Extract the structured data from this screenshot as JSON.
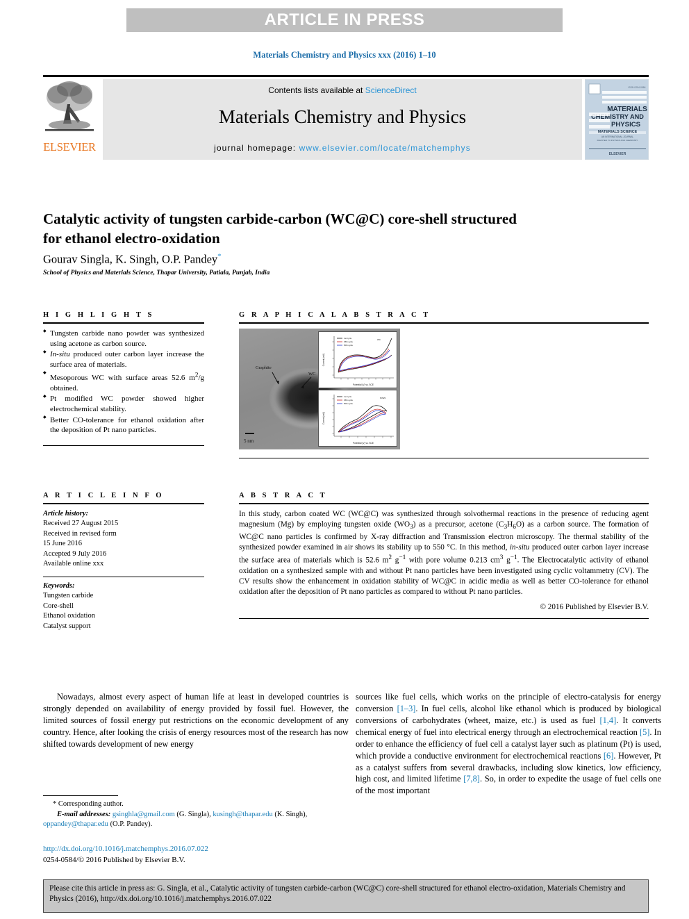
{
  "banner": {
    "text": "ARTICLE IN PRESS"
  },
  "running_head": "Materials Chemistry and Physics xxx (2016) 1–10",
  "masthead": {
    "contents_prefix": "Contents lists available at ",
    "contents_link": "ScienceDirect",
    "journal_name": "Materials Chemistry and Physics",
    "homepage_prefix": "journal homepage: ",
    "homepage_url": "www.elsevier.com/locate/matchemphys",
    "publisher_logo_text": "ELSEVIER",
    "cover_title_lines": [
      "MATERIALS",
      "CHEMISTRY AND",
      "PHYSICS"
    ]
  },
  "article": {
    "title": "Catalytic activity of tungsten carbide-carbon (WC@C) core-shell structured for ethanol electro-oxidation",
    "authors": "Gourav Singla, K. Singh, O.P. Pandey",
    "corresponding_marker": "*",
    "affiliation": "School of Physics and Materials Science, Thapar University, Patiala, Punjab, India"
  },
  "highlights": {
    "heading": "H I G H L I G H T S",
    "items": [
      "Tungsten carbide nano powder was synthesized using acetone as carbon source.",
      "In-situ produced outer carbon layer increase the surface area of materials.",
      "Mesoporous WC with surface areas 52.6 m2/g obtained.",
      "Pt modified WC powder showed higher electrochemical stability.",
      "Better CO-tolerance for ethanol oxidation after the deposition of Pt nano particles."
    ]
  },
  "graphical_abstract": {
    "heading": "G R A P H I C A L   A B S T R A C T",
    "figure": {
      "type": "TEM micrograph with two cyclic-voltammetry insets",
      "labels": [
        "Graphite",
        "WC"
      ],
      "scale_bar": "5 nm",
      "insets": [
        {
          "legend": [
            "1st cycle",
            "25th cycle",
            "50th cycle"
          ],
          "xlabel": "Potential (V) vs. SCE",
          "ylabel": "Current (mA)",
          "annotation": "WC"
        },
        {
          "legend": [
            "1st cycle",
            "25th cycle",
            "50th cycle"
          ],
          "xlabel": "Potential (V) vs. SCE",
          "ylabel": "Current (mA)",
          "annotation": "Pt/WC"
        }
      ]
    }
  },
  "article_info": {
    "heading": "A R T I C L E   I N F O",
    "history_label": "Article history:",
    "history": [
      "Received 27 August 2015",
      "Received in revised form",
      "15 June 2016",
      "Accepted 9 July 2016",
      "Available online xxx"
    ],
    "keywords_label": "Keywords:",
    "keywords": [
      "Tungsten carbide",
      "Core-shell",
      "Ethanol oxidation",
      "Catalyst support"
    ]
  },
  "abstract": {
    "heading": "A B S T R A C T",
    "body_part1": "In this study, carbon coated WC (WC@C) was synthesized through solvothermal reactions in the presence of reducing agent magnesium (Mg) by employing tungsten oxide (WO",
    "body_sub1": "3",
    "body_part2": ") as a precursor, acetone (C",
    "body_sub2": "3",
    "body_part3": "H",
    "body_sub3": "6",
    "body_part4": "O) as a carbon source. The formation of WC@C nano particles is confirmed by X-ray diffraction and Transmission electron microscopy. The thermal stability of the synthesized powder examined in air shows its stability up to 550 °C. In this method, ",
    "body_italic1": "in-situ",
    "body_part5": " produced outer carbon layer increase the surface area of materials which is 52.6 m",
    "body_sup1": "2",
    "body_part6": " g",
    "body_sup2": "−1",
    "body_part7": " with pore volume 0.213 cm",
    "body_sup3": "3",
    "body_part8": " g",
    "body_sup4": "−1",
    "body_part9": ". The Electrocatalytic activity of ethanol oxidation on a synthesized sample with and without Pt nano particles have been investigated using cyclic voltammetry (CV). The CV results show the enhancement in oxidation stability of WC@C in acidic media as well as better CO-tolerance for ethanol oxidation after the deposition of Pt nano particles as compared to without Pt nano particles.",
    "copyright": "© 2016 Published by Elsevier B.V."
  },
  "body": {
    "left_paragraph": "Nowadays, almost every aspect of human life at least in developed countries is strongly depended on availability of energy provided by fossil fuel. However, the limited sources of fossil energy put restrictions on the economic development of any country. Hence, after looking the crisis of energy resources most of the research has now shifted towards development of new energy",
    "right_seg1": "sources like fuel cells, which works on the principle of electro-catalysis for energy conversion ",
    "right_ref1": "[1–3]",
    "right_seg2": ". In fuel cells, alcohol like ethanol which is produced by biological conversions of carbohydrates (wheet, maize, etc.) is used as fuel ",
    "right_ref2": "[1,4]",
    "right_seg3": ". It converts chemical energy of fuel into electrical energy through an electrochemical reaction ",
    "right_ref3": "[5]",
    "right_seg4": ". In order to enhance the efficiency of fuel cell a catalyst layer such as platinum (Pt) is used, which provide a conductive environment for electrochemical reactions ",
    "right_ref4": "[6]",
    "right_seg5": ". However, Pt as a catalyst suffers from several drawbacks, including slow kinetics, low efficiency, high cost, and limited lifetime ",
    "right_ref5": "[7,8]",
    "right_seg6": ". So, in order to expedite the usage of fuel cells one of the most important"
  },
  "footnote": {
    "corresponding": "Corresponding author.",
    "email_label": "E-mail addresses:",
    "email1": "gsinghla@gmail.com",
    "email1_owner": "(G. Singla),",
    "email2": "kusingh@thapar.edu",
    "email2_owner": "(K. Singh),",
    "email3": "oppandey@thapar.edu",
    "email3_owner": "(O.P. Pandey)."
  },
  "doi": {
    "url": "http://dx.doi.org/10.1016/j.matchemphys.2016.07.022",
    "issn_line": "0254-0584/© 2016 Published by Elsevier B.V."
  },
  "cite_box": {
    "text": "Please cite this article in press as: G. Singla, et al., Catalytic activity of tungsten carbide-carbon (WC@C) core-shell structured for ethanol electro-oxidation, Materials Chemistry and Physics (2016), http://dx.doi.org/10.1016/j.matchemphys.2016.07.022"
  },
  "colors": {
    "banner_bg": "#bfbfbf",
    "link_blue": "#2a94d6",
    "ref_blue": "#1b7fb8",
    "elsevier_orange": "#e87722",
    "band_gray": "#e6e6e6",
    "cite_gray": "#c6c6c6"
  }
}
